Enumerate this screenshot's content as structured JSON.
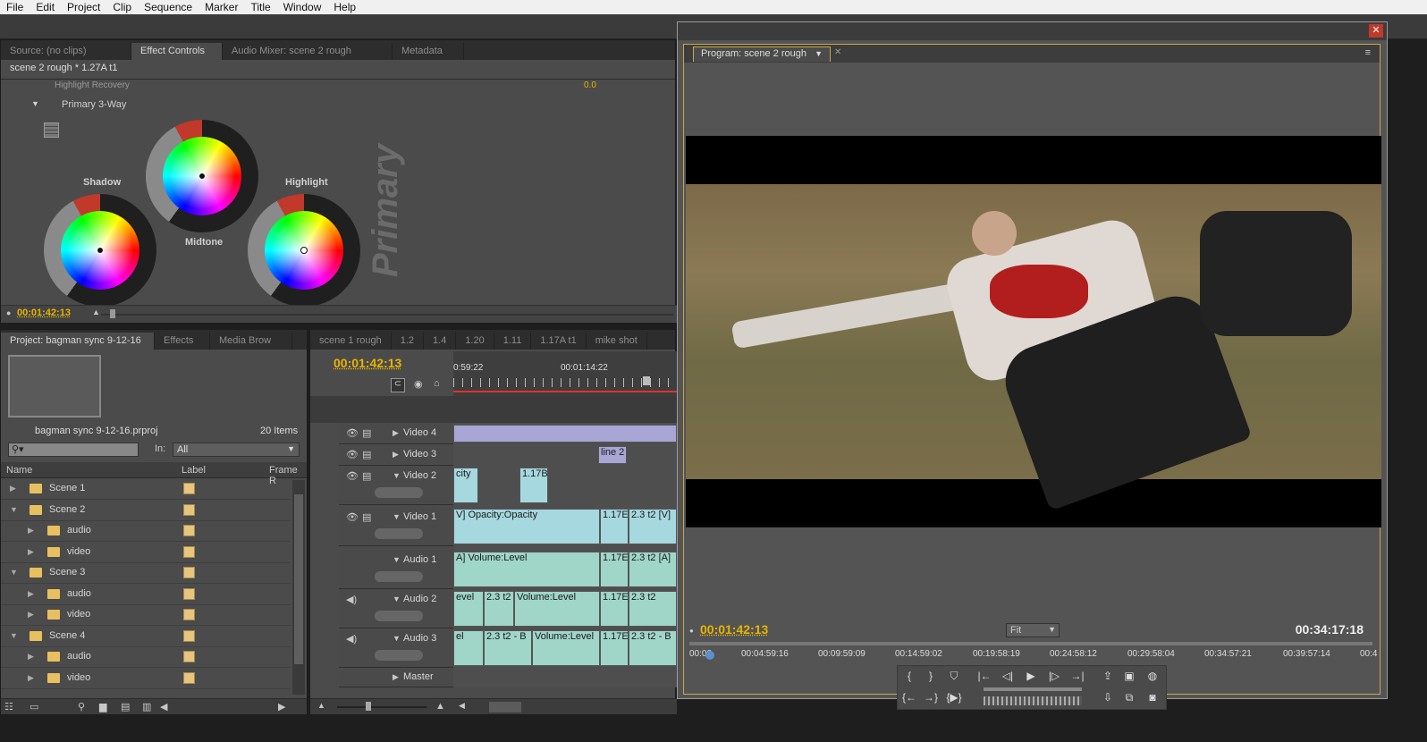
{
  "menu": [
    "File",
    "Edit",
    "Project",
    "Clip",
    "Sequence",
    "Marker",
    "Title",
    "Window",
    "Help"
  ],
  "source_panel": {
    "tabs": [
      "Source: (no clips)",
      "Effect Controls",
      "Audio Mixer: scene 2 rough",
      "Metadata"
    ],
    "active_tab": 1,
    "clip_header": "scene 2 rough * 1.27A t1",
    "partial_row": "Highlight Recovery",
    "partial_value": "0.0",
    "section": "Primary 3-Way",
    "wheels": {
      "shadow": "Shadow",
      "midtone": "Midtone",
      "highlight": "Highlight"
    },
    "watermark": "Primary",
    "timecode": "00:01:42:13"
  },
  "project": {
    "tabs": [
      "Project: bagman sync 9-12-16",
      "Effects",
      "Media Brow"
    ],
    "filename": "bagman sync 9-12-16.prproj",
    "items_count": "20 Items",
    "in_label": "In:",
    "in_value": "All",
    "columns": [
      "Name",
      "Label",
      "Frame R"
    ],
    "rows": [
      {
        "name": "Scene 1",
        "expanded": false,
        "level": 0
      },
      {
        "name": "Scene 2",
        "expanded": true,
        "level": 0
      },
      {
        "name": "audio",
        "expanded": false,
        "level": 1
      },
      {
        "name": "video",
        "expanded": false,
        "level": 1
      },
      {
        "name": "Scene 3",
        "expanded": true,
        "level": 0
      },
      {
        "name": "audio",
        "expanded": false,
        "level": 1
      },
      {
        "name": "video",
        "expanded": false,
        "level": 1
      },
      {
        "name": "Scene 4",
        "expanded": true,
        "level": 0
      },
      {
        "name": "audio",
        "expanded": false,
        "level": 1
      },
      {
        "name": "video",
        "expanded": false,
        "level": 1
      }
    ]
  },
  "timeline": {
    "tabs": [
      "scene 1 rough",
      "1.2",
      "1.4",
      "1.20",
      "1.11",
      "1.17A t1",
      "mike shot"
    ],
    "timecode": "00:01:42:13",
    "ruler": [
      "0:59:22",
      "00:01:14:22"
    ],
    "tracks": [
      "Video 4",
      "Video 3",
      "Video 2",
      "Video 1",
      "Audio 1",
      "Audio 2",
      "Audio 3",
      "Master"
    ],
    "clips": {
      "v3": "line 2",
      "v2a": "city",
      "v2b": "1.17B",
      "v1a": "V] Opacity:Opacity",
      "v1b": "1.17E",
      "v1c": "2.3 t2 [V]",
      "a1a": "A] Volume:Level",
      "a1b": "1.17E",
      "a1c": "2.3 t2 [A]",
      "a2a": "evel",
      "a2b": "2.3 t2",
      "a2c": "Volume:Level",
      "a2d": "1.17E",
      "a2e": "2.3 t2",
      "a3a": "el",
      "a3b": "2.3 t2 - B",
      "a3c": "Volume:Level",
      "a3d": "1.17E",
      "a3e": "2.3 t2 - B"
    }
  },
  "program": {
    "title": "Program: scene 2 rough",
    "timecode": "00:01:42:13",
    "fit": "Fit",
    "duration": "00:34:17:18",
    "ruler": [
      "00:00",
      "00:04:59:16",
      "00:09:59:09",
      "00:14:59:02",
      "00:19:58:19",
      "00:24:58:12",
      "00:29:58:04",
      "00:34:57:21",
      "00:39:57:14",
      "00:4"
    ]
  }
}
